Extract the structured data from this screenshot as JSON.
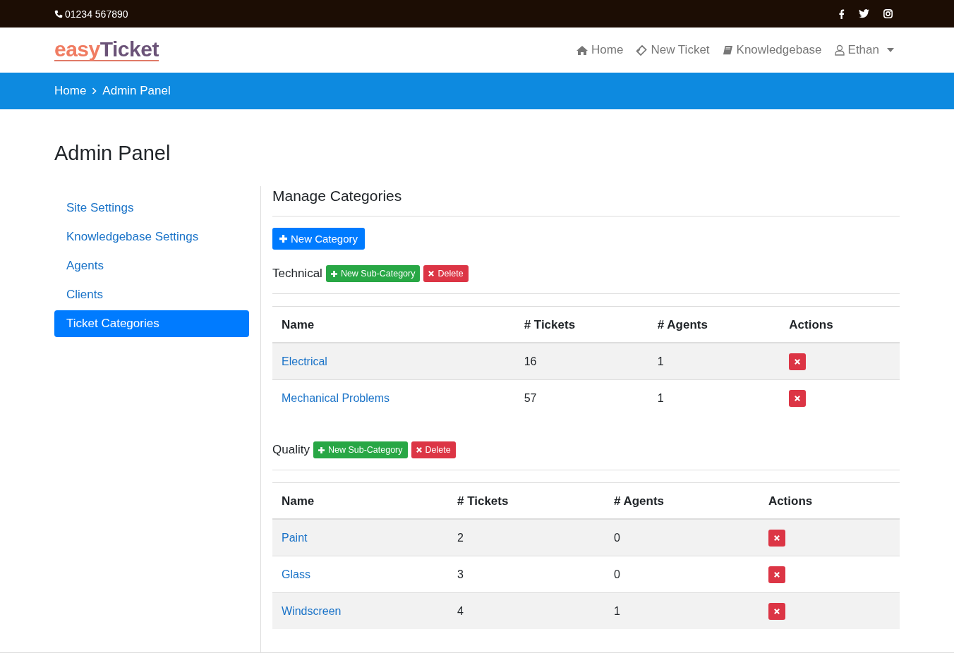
{
  "topbar": {
    "phone": "01234 567890"
  },
  "logo": {
    "first": "easy",
    "second": "Ticket"
  },
  "nav": [
    {
      "kind": "home",
      "label": "Home"
    },
    {
      "kind": "ticket",
      "label": "New Ticket"
    },
    {
      "kind": "book",
      "label": "Knowledgebase"
    },
    {
      "kind": "user",
      "label": "Ethan"
    }
  ],
  "breadcrumb": [
    "Home",
    "Admin Panel"
  ],
  "page_title": "Admin Panel",
  "sidebar": {
    "items": [
      {
        "label": "Site Settings",
        "selected": false
      },
      {
        "label": "Knowledgebase Settings",
        "selected": false
      },
      {
        "label": "Agents",
        "selected": false
      },
      {
        "label": "Clients",
        "selected": false
      },
      {
        "label": "Ticket Categories",
        "selected": true
      }
    ]
  },
  "section_title": "Manage Categories",
  "new_category_button": "New Category",
  "categories": [
    {
      "name": "Technical",
      "sub_button": "New Sub-Category",
      "delete_button": "Delete",
      "columns": [
        "Name",
        "# Tickets",
        "# Agents",
        "Actions"
      ],
      "rows": [
        {
          "name": "Electrical",
          "tickets": "16",
          "agents": "1"
        },
        {
          "name": "Mechanical Problems",
          "tickets": "57",
          "agents": "1"
        }
      ]
    },
    {
      "name": "Quality",
      "sub_button": "New Sub-Category",
      "delete_button": "Delete",
      "columns": [
        "Name",
        "# Tickets",
        "# Agents",
        "Actions"
      ],
      "rows": [
        {
          "name": "Paint",
          "tickets": "2",
          "agents": "0"
        },
        {
          "name": "Glass",
          "tickets": "3",
          "agents": "0"
        },
        {
          "name": "Windscreen",
          "tickets": "4",
          "agents": "1"
        }
      ]
    }
  ]
}
